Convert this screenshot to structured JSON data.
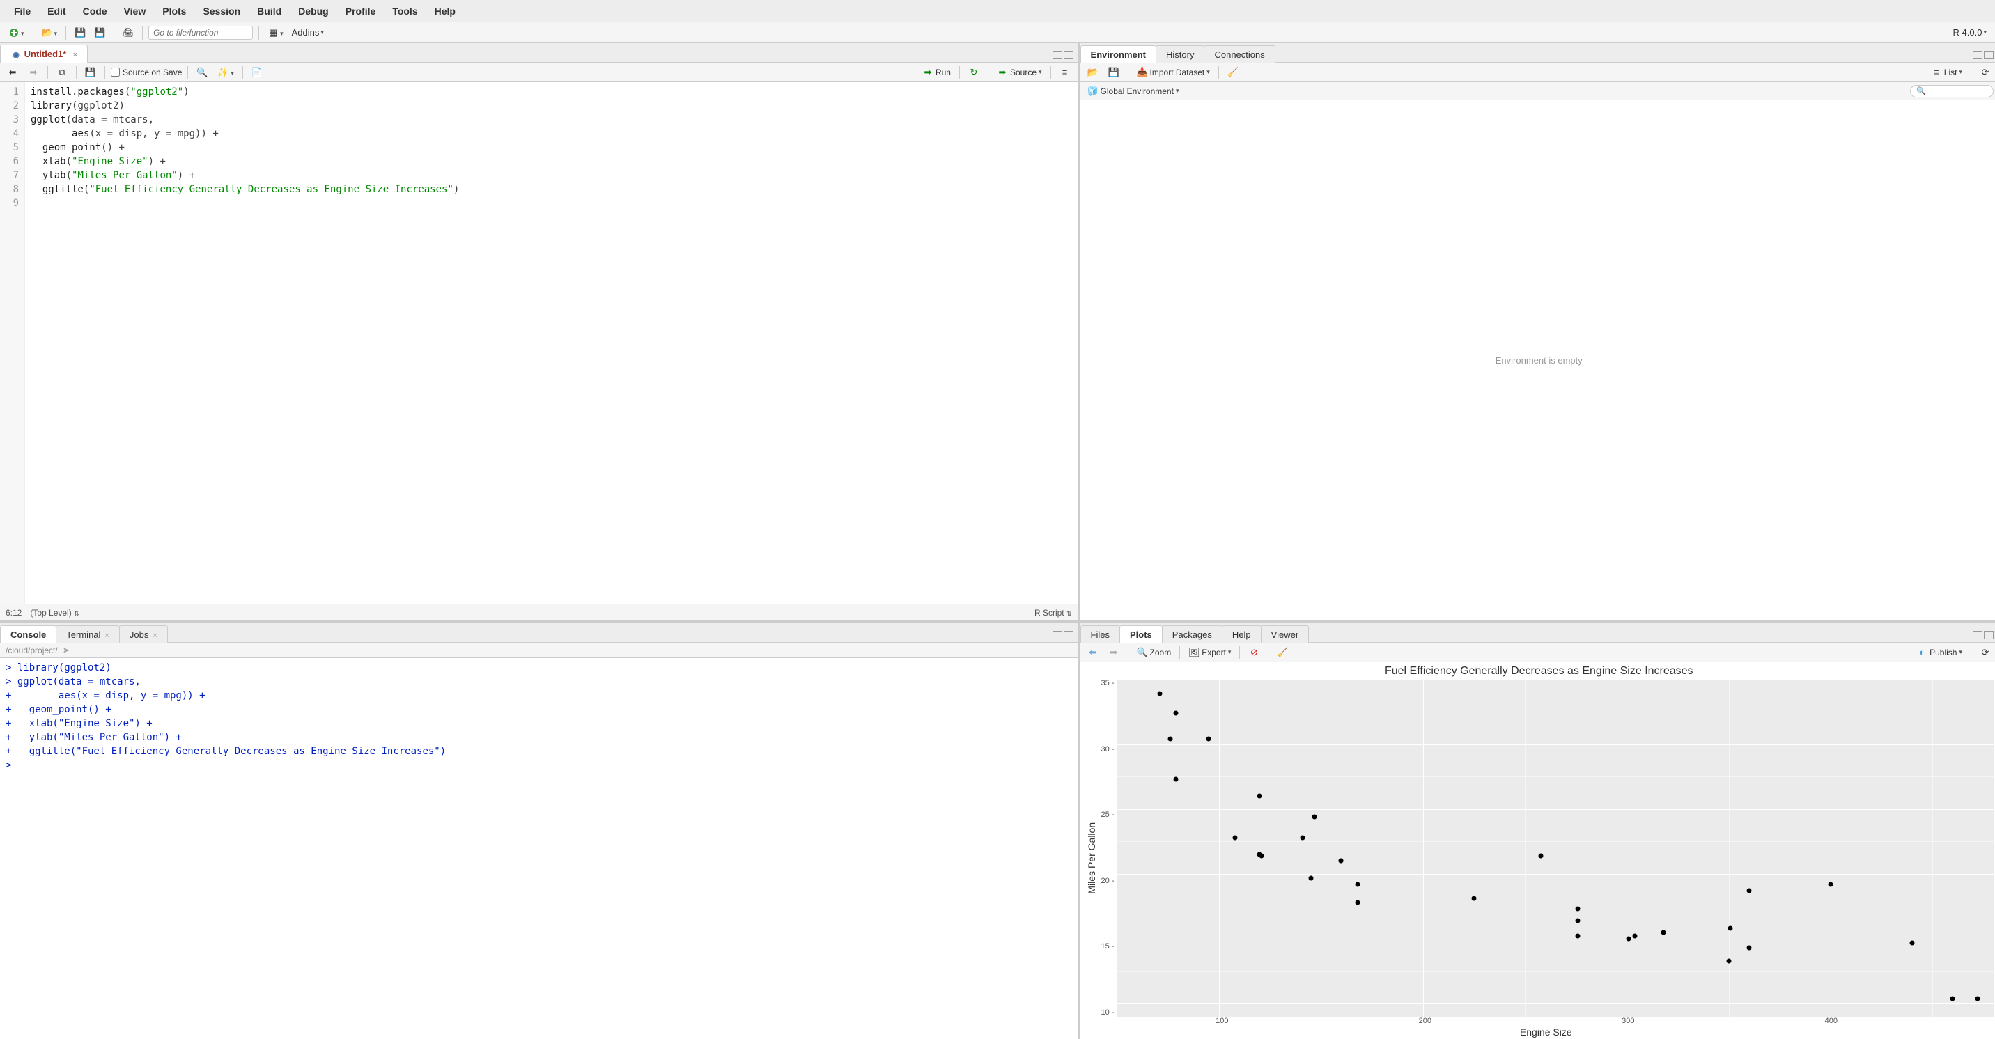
{
  "menu": [
    "File",
    "Edit",
    "Code",
    "View",
    "Plots",
    "Session",
    "Build",
    "Debug",
    "Profile",
    "Tools",
    "Help"
  ],
  "toolbar": {
    "goto_placeholder": "Go to file/function",
    "addins": "Addins",
    "r_version": "R 4.0.0"
  },
  "source_panel": {
    "tab": "Untitled1*",
    "source_on_save": "Source on Save",
    "run": "Run",
    "source_btn": "Source",
    "cursor": "6:12",
    "scope": "(Top Level)",
    "lang": "R Script",
    "code": [
      {
        "n": 1,
        "tokens": [
          {
            "t": "install.packages",
            "c": "fn"
          },
          {
            "t": "(",
            "c": "op"
          },
          {
            "t": "\"ggplot2\"",
            "c": "str"
          },
          {
            "t": ")",
            "c": "op"
          }
        ]
      },
      {
        "n": 2,
        "tokens": [
          {
            "t": "library",
            "c": "fn"
          },
          {
            "t": "(ggplot2)",
            "c": "op"
          }
        ]
      },
      {
        "n": 3,
        "tokens": [
          {
            "t": "ggplot",
            "c": "fn"
          },
          {
            "t": "(data = mtcars,",
            "c": "op"
          }
        ]
      },
      {
        "n": 4,
        "tokens": [
          {
            "t": "       ",
            "c": "op"
          },
          {
            "t": "aes",
            "c": "fn"
          },
          {
            "t": "(x = disp, y = mpg)) +",
            "c": "op"
          }
        ]
      },
      {
        "n": 5,
        "tokens": [
          {
            "t": "  ",
            "c": ""
          },
          {
            "t": "geom_point",
            "c": "fn"
          },
          {
            "t": "() +",
            "c": "op"
          }
        ]
      },
      {
        "n": 6,
        "tokens": [
          {
            "t": "  ",
            "c": ""
          },
          {
            "t": "xlab",
            "c": "fn"
          },
          {
            "t": "(",
            "c": "op"
          },
          {
            "t": "\"Engine Size\"",
            "c": "str"
          },
          {
            "t": ") +",
            "c": "op"
          }
        ]
      },
      {
        "n": 7,
        "tokens": [
          {
            "t": "  ",
            "c": ""
          },
          {
            "t": "ylab",
            "c": "fn"
          },
          {
            "t": "(",
            "c": "op"
          },
          {
            "t": "\"Miles Per Gallon\"",
            "c": "str"
          },
          {
            "t": ") +",
            "c": "op"
          }
        ]
      },
      {
        "n": 8,
        "tokens": [
          {
            "t": "  ",
            "c": ""
          },
          {
            "t": "ggtitle",
            "c": "fn"
          },
          {
            "t": "(",
            "c": "op"
          },
          {
            "t": "\"Fuel Efficiency Generally Decreases as Engine Size Increases\"",
            "c": "str"
          },
          {
            "t": ")",
            "c": "op"
          }
        ]
      },
      {
        "n": 9,
        "tokens": [
          {
            "t": "",
            "c": ""
          }
        ]
      }
    ]
  },
  "console_panel": {
    "tabs": [
      "Console",
      "Terminal",
      "Jobs"
    ],
    "active": 0,
    "path": "/cloud/project/",
    "lines": [
      "> library(ggplot2)",
      "> ggplot(data = mtcars,",
      "+        aes(x = disp, y = mpg)) +",
      "+   geom_point() +",
      "+   xlab(\"Engine Size\") +",
      "+   ylab(\"Miles Per Gallon\") +",
      "+   ggtitle(\"Fuel Efficiency Generally Decreases as Engine Size Increases\")",
      "> "
    ]
  },
  "env_panel": {
    "tabs": [
      "Environment",
      "History",
      "Connections"
    ],
    "import": "Import Dataset",
    "list": "List",
    "global_env": "Global Environment",
    "empty": "Environment is empty"
  },
  "plots_panel": {
    "tabs": [
      "Files",
      "Plots",
      "Packages",
      "Help",
      "Viewer"
    ],
    "active": 1,
    "zoom": "Zoom",
    "export": "Export",
    "publish": "Publish"
  },
  "chart_data": {
    "type": "scatter",
    "title": "Fuel Efficiency Generally Decreases as Engine Size Increases",
    "xlabel": "Engine Size",
    "ylabel": "Miles Per Gallon",
    "xlim": [
      50,
      480
    ],
    "ylim": [
      9,
      35
    ],
    "x_ticks": [
      100,
      200,
      300,
      400
    ],
    "y_ticks": [
      10,
      15,
      20,
      25,
      30,
      35
    ],
    "points": [
      {
        "x": 160,
        "y": 21.0
      },
      {
        "x": 160,
        "y": 21.0
      },
      {
        "x": 108,
        "y": 22.8
      },
      {
        "x": 258,
        "y": 21.4
      },
      {
        "x": 360,
        "y": 18.7
      },
      {
        "x": 225,
        "y": 18.1
      },
      {
        "x": 360,
        "y": 14.3
      },
      {
        "x": 147,
        "y": 24.4
      },
      {
        "x": 141,
        "y": 22.8
      },
      {
        "x": 168,
        "y": 19.2
      },
      {
        "x": 168,
        "y": 17.8
      },
      {
        "x": 276,
        "y": 16.4
      },
      {
        "x": 276,
        "y": 17.3
      },
      {
        "x": 276,
        "y": 15.2
      },
      {
        "x": 472,
        "y": 10.4
      },
      {
        "x": 460,
        "y": 10.4
      },
      {
        "x": 440,
        "y": 14.7
      },
      {
        "x": 79,
        "y": 32.4
      },
      {
        "x": 76,
        "y": 30.4
      },
      {
        "x": 71,
        "y": 33.9
      },
      {
        "x": 120,
        "y": 21.5
      },
      {
        "x": 318,
        "y": 15.5
      },
      {
        "x": 304,
        "y": 15.2
      },
      {
        "x": 350,
        "y": 13.3
      },
      {
        "x": 400,
        "y": 19.2
      },
      {
        "x": 79,
        "y": 27.3
      },
      {
        "x": 120,
        "y": 26.0
      },
      {
        "x": 95,
        "y": 30.4
      },
      {
        "x": 351,
        "y": 15.8
      },
      {
        "x": 145,
        "y": 19.7
      },
      {
        "x": 301,
        "y": 15.0
      },
      {
        "x": 121,
        "y": 21.4
      }
    ]
  }
}
